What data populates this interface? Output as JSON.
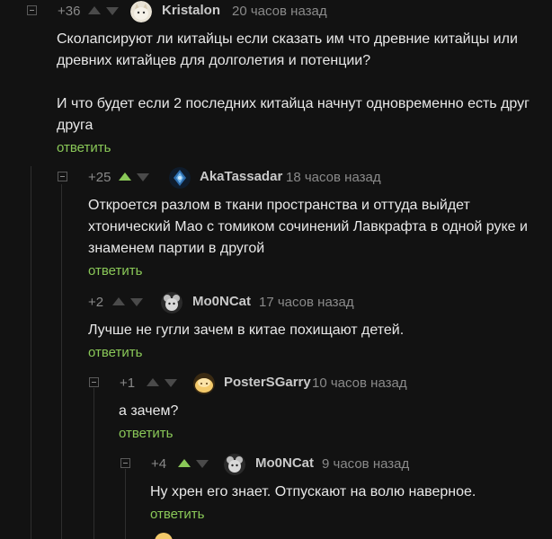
{
  "theme": {
    "background": "#121212",
    "accent": "#8ac858",
    "text": "#e8e8e8",
    "muted": "#8a8a8a"
  },
  "comments": [
    {
      "rating": "+36",
      "vote": "none",
      "avatar_icon": "white-cat-avatar",
      "username": "Kristalon",
      "timestamp": "20 часов назад",
      "body": [
        "Сколапсируют ли китайцы если сказать им что древние китайцы или древних китайцев для долголетия и потенции?",
        "И что будет если 2 последних китайца начнут одновременно есть друг друга"
      ],
      "reply_label": "ответить"
    },
    {
      "rating": "+25",
      "vote": "up",
      "avatar_icon": "blue-wizard-avatar",
      "username": "AkaTassadar",
      "timestamp": "18 часов назад",
      "body": [
        "Откроется разлом в ткани пространства и оттуда выйдет хтонический Мао с томиком сочинений Лавкрафта в одной руке и знаменем партии в другой"
      ],
      "reply_label": "ответить"
    },
    {
      "rating": "+2",
      "vote": "none",
      "avatar_icon": "grey-mouse-avatar",
      "username": "Mo0NCat",
      "timestamp": "17 часов назад",
      "body": [
        "Лучше не гугли зачем в китае похищают детей."
      ],
      "reply_label": "ответить"
    },
    {
      "rating": "+1",
      "vote": "none",
      "avatar_icon": "yellow-blob-avatar",
      "username": "PosterSGarry",
      "timestamp": "10 часов назад",
      "body": [
        "а зачем?"
      ],
      "reply_label": "ответить"
    },
    {
      "rating": "+4",
      "vote": "up",
      "avatar_icon": "grey-mouse-avatar",
      "username": "Mo0NCat",
      "timestamp": "9 часов назад",
      "body": [
        "Ну хрен его знает. Отпускают на волю наверное."
      ],
      "reply_label": "ответить"
    }
  ]
}
